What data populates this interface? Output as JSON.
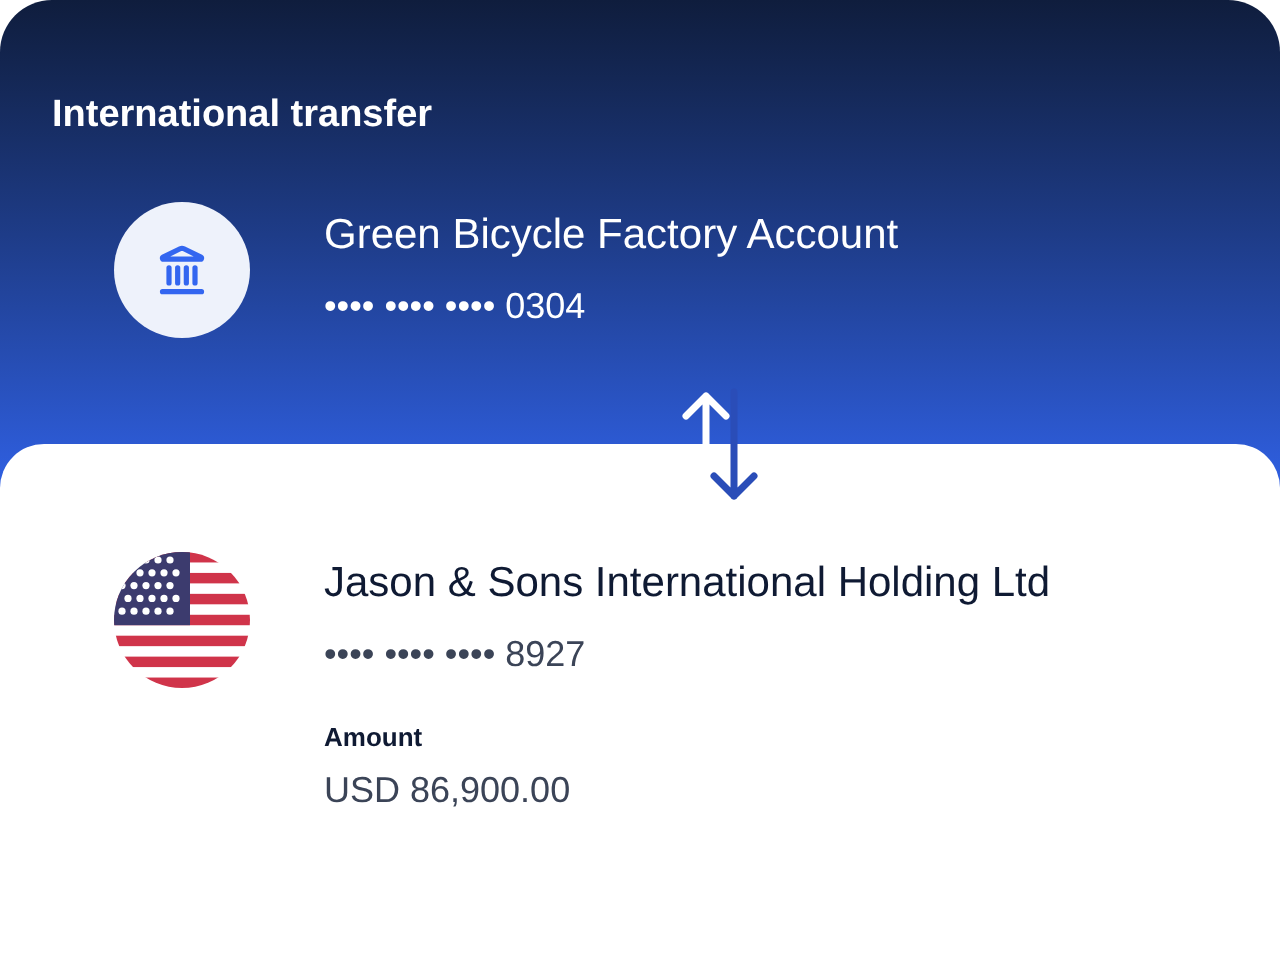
{
  "title": "International transfer",
  "from": {
    "name": "Green Bicycle Factory Account",
    "number": "•••• •••• •••• 0304"
  },
  "to": {
    "name": "Jason & Sons International Holding Ltd",
    "number": "•••• •••• •••• 8927",
    "amount_label": "Amount",
    "amount": "USD 86,900.00"
  }
}
